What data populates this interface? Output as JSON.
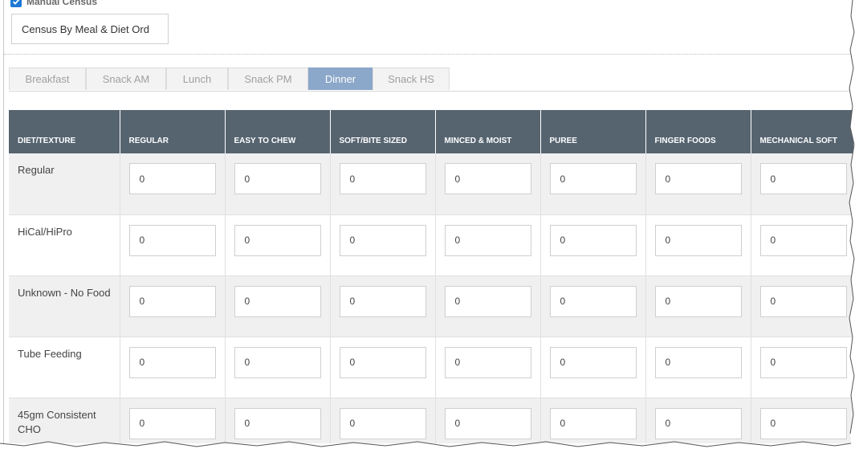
{
  "manual_census": {
    "label": "Manual Census",
    "checked": true
  },
  "census_button": {
    "label": "Census By Meal & Diet Ord"
  },
  "meal_tabs": [
    {
      "label": "Breakfast",
      "active": false
    },
    {
      "label": "Snack AM",
      "active": false
    },
    {
      "label": "Lunch",
      "active": false
    },
    {
      "label": "Snack PM",
      "active": false
    },
    {
      "label": "Dinner",
      "active": true
    },
    {
      "label": "Snack HS",
      "active": false
    }
  ],
  "table": {
    "columns": [
      "DIET/TEXTURE",
      "REGULAR",
      "EASY TO CHEW",
      "SOFT/BITE SIZED",
      "MINCED & MOIST",
      "PUREE",
      "FINGER FOODS",
      "MECHANICAL SOFT"
    ],
    "rows": [
      {
        "label": "Regular",
        "values": [
          "0",
          "0",
          "0",
          "0",
          "0",
          "0",
          "0"
        ]
      },
      {
        "label": "HiCal/HiPro",
        "values": [
          "0",
          "0",
          "0",
          "0",
          "0",
          "0",
          "0"
        ]
      },
      {
        "label": "Unknown - No Food",
        "values": [
          "0",
          "0",
          "0",
          "0",
          "0",
          "0",
          "0"
        ]
      },
      {
        "label": "Tube Feeding",
        "values": [
          "0",
          "0",
          "0",
          "0",
          "0",
          "0",
          "0"
        ]
      },
      {
        "label": "45gm Consistent CHO",
        "values": [
          "0",
          "0",
          "0",
          "0",
          "0",
          "0",
          "0"
        ]
      }
    ]
  },
  "colors": {
    "header_bg": "#566470",
    "active_tab": "#8ba7c9",
    "checkbox": "#1e78d4"
  }
}
